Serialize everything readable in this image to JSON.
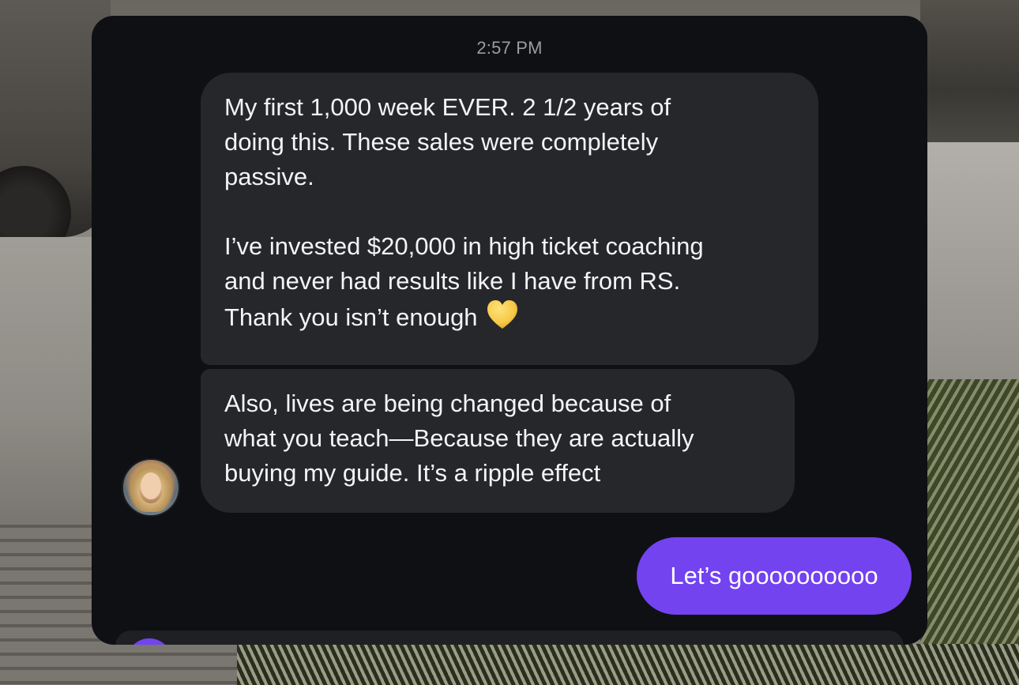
{
  "conversation": {
    "timestamp": "2:57 PM",
    "received_messages": [
      {
        "text": "My first 1,000 week EVER. 2 1/2 years of\ndoing this. These sales were completely\npassive.\n\nI’ve invested $20,000 in high ticket coaching\nand never had results like I have from RS.\nThank you isn’t enough",
        "emoji": "yellow-heart"
      },
      {
        "text": "Also, lives are being changed because of\nwhat you teach—Because they are actually\nbuying my guide. It’s a ripple effect"
      }
    ],
    "sent_messages": [
      {
        "text": "Let’s goooooooooo"
      }
    ]
  },
  "colors": {
    "panel_background": "#0f1013",
    "received_bubble": "#26272b",
    "sent_bubble": "#7343f0",
    "heart": "#f7c948"
  }
}
